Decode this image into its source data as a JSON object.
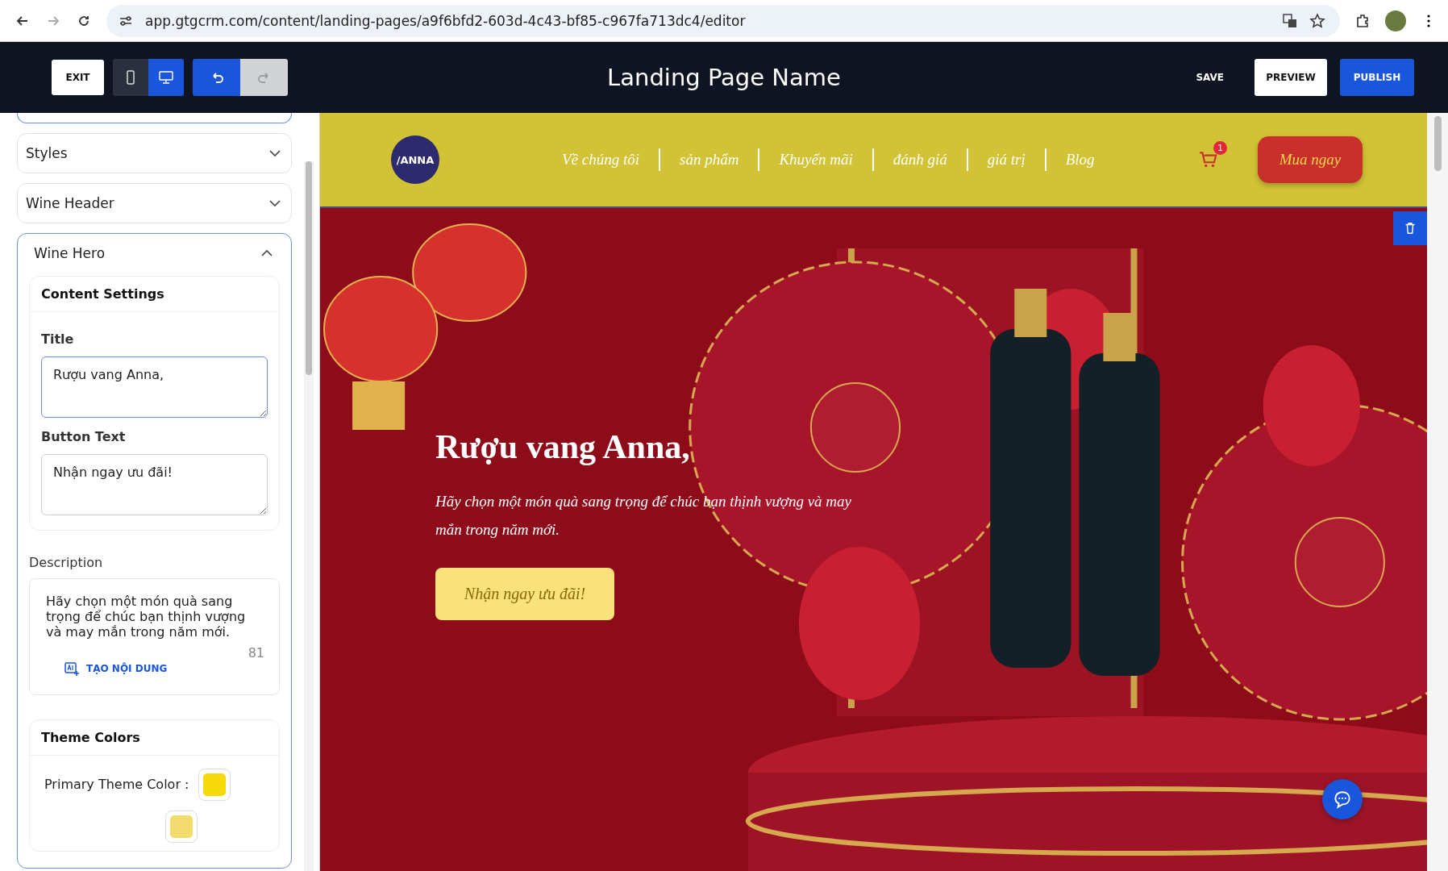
{
  "browser": {
    "url": "app.gtgcrm.com/content/landing-pages/a9f6bfd2-603d-4c43-bf85-c967fa713dc4/editor"
  },
  "toolbar": {
    "exit": "EXIT",
    "devices": [
      {
        "kind": "mobile",
        "selected": false
      },
      {
        "kind": "desktop",
        "selected": true
      }
    ],
    "history": [
      {
        "kind": "undo",
        "disabled": false
      },
      {
        "kind": "redo",
        "disabled": true
      }
    ],
    "title": "Landing Page Name",
    "save": "SAVE",
    "preview": "PREVIEW",
    "publish": "PUBLISH"
  },
  "sidebar": {
    "sections": [
      {
        "title": "Styles",
        "expanded": false
      },
      {
        "title": "Wine Header",
        "expanded": false
      },
      {
        "title": "Wine Hero",
        "expanded": true
      }
    ],
    "content_settings": {
      "heading": "Content Settings",
      "fields": [
        {
          "label": "Title",
          "value": "Rượu vang Anna, ",
          "focused": true
        },
        {
          "label": "Button Text",
          "value": "Nhận ngay ưu đãi!",
          "focused": false
        }
      ]
    },
    "description": {
      "label": "Description",
      "value": "Hãy chọn một món quà sang trọng để chúc bạn thịnh vượng và may mắn trong năm mới.",
      "count": "81",
      "generate": "TẠO NỘI DUNG"
    },
    "theme_colors": {
      "heading": "Theme Colors",
      "items": [
        {
          "label": "Primary Theme Color :",
          "color": "#f5d90a"
        },
        {
          "color": "#f3dc6e"
        }
      ]
    }
  },
  "preview": {
    "logo": "/ANNA",
    "nav": [
      "Về chúng tôi",
      "sản phẩm",
      "Khuyến mãi",
      "đánh giá",
      "giá trị",
      "Blog"
    ],
    "cart_count": "1",
    "buy": "Mua ngay",
    "hero": {
      "title": "Rượu vang Anna,",
      "description": "Hãy chọn một món quà sang trọng để chúc bạn thịnh vượng và may mắn trong năm mới.",
      "button": "Nhận ngay ưu đãi!"
    }
  }
}
